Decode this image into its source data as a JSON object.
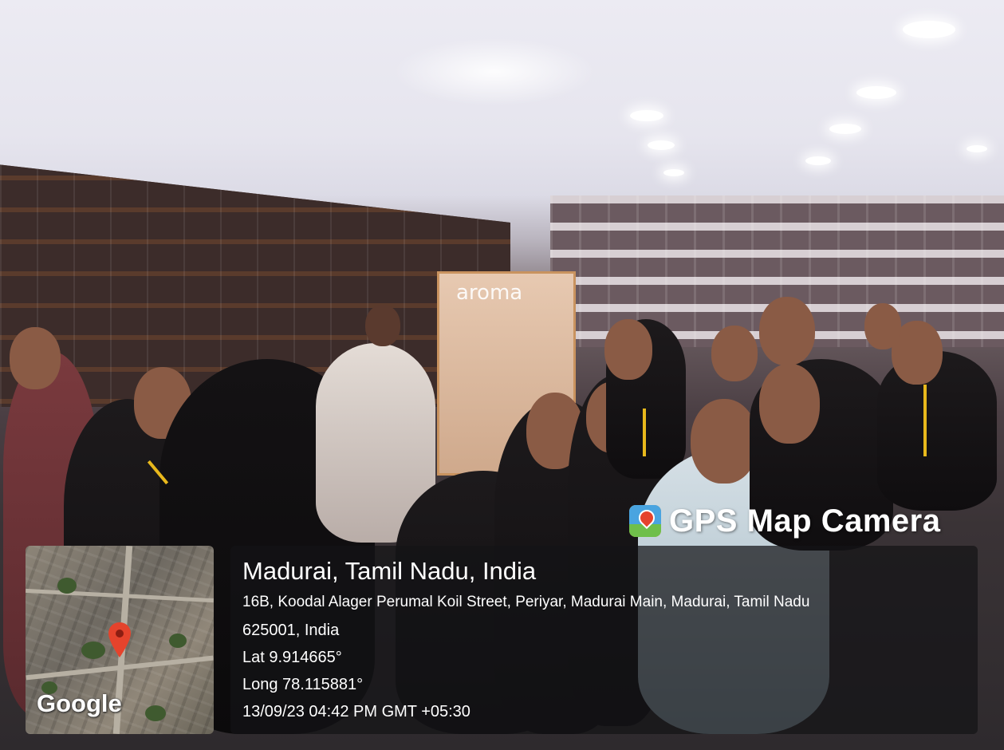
{
  "overlay": {
    "brand": "GPS Map Camera",
    "brand_icon": "gps-map-camera-app-icon",
    "map_provider": "Google",
    "location_title": "Madurai, Tamil Nadu, India",
    "address_line1": "16B, Koodal Alager Perumal Koil Street, Periyar, Madurai Main, Madurai, Tamil Nadu",
    "address_line2": "625001, India",
    "latitude": "Lat 9.914665°",
    "longitude": "Long 78.115881°",
    "timestamp": "13/09/23 04:42 PM GMT +05:30"
  },
  "photo": {
    "store_display_text": "aroma"
  },
  "colors": {
    "pin_red": "#e5432c",
    "overlay_bg": "rgba(20,20,22,0.72)",
    "lanyard_yellow": "#e8b81c"
  }
}
